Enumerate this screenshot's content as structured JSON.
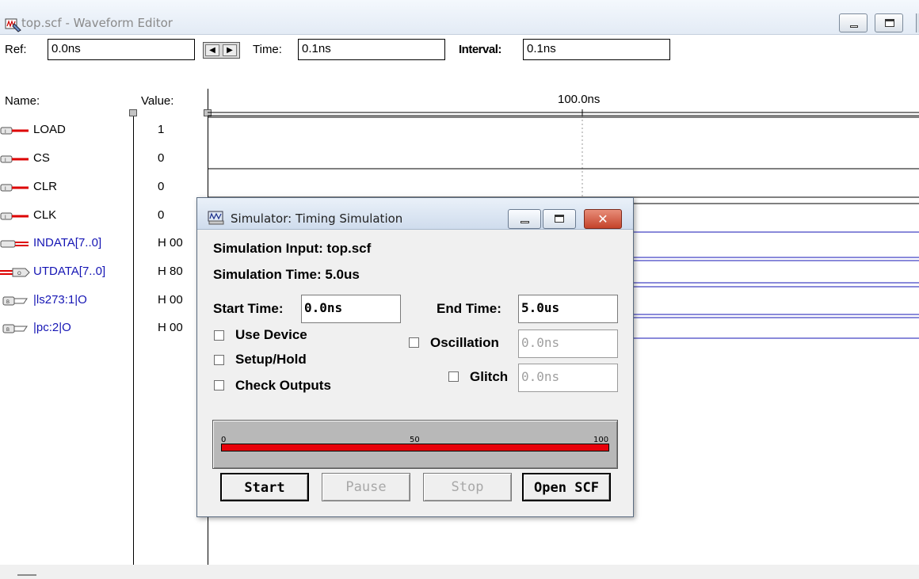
{
  "window": {
    "title": "top.scf - Waveform Editor"
  },
  "toolbar": {
    "ref_label": "Ref:",
    "ref_value": "0.0ns",
    "time_label": "Time:",
    "time_value": "0.1ns",
    "interval_label": "Interval:",
    "interval_value": "0.1ns"
  },
  "waveform": {
    "name_header": "Name:",
    "value_header": "Value:",
    "time_marker": "100.0ns",
    "signals": [
      {
        "name": "LOAD",
        "value": "1",
        "icon": "input-pin-icon",
        "color": "#000000"
      },
      {
        "name": "CS",
        "value": "0",
        "icon": "input-pin-icon",
        "color": "#000000"
      },
      {
        "name": "CLR",
        "value": "0",
        "icon": "input-pin-icon",
        "color": "#000000"
      },
      {
        "name": "CLK",
        "value": "0",
        "icon": "input-pin-icon",
        "color": "#000000"
      },
      {
        "name": "INDATA[7..0]",
        "value": "H 00",
        "icon": "input-bus-icon",
        "color": "#1515b4"
      },
      {
        "name": "UTDATA[7..0]",
        "value": "H 80",
        "icon": "output-bus-icon",
        "color": "#1515b4"
      },
      {
        "name": "|ls273:1|O",
        "value": "H 00",
        "icon": "buried-node-icon",
        "color": "#1515b4"
      },
      {
        "name": "|pc:2|O",
        "value": "H 00",
        "icon": "buried-node-icon",
        "color": "#1515b4"
      }
    ]
  },
  "dialog": {
    "title": "Simulator: Timing Simulation",
    "input_label": "Simulation Input: top.scf",
    "time_label": "Simulation Time: 5.0us",
    "start_time_label": "Start Time:",
    "start_time_value": "0.0ns",
    "end_time_label": "End Time:",
    "end_time_value": "5.0us",
    "use_device_label": "Use Device",
    "setup_hold_label": "Setup/Hold",
    "check_outputs_label": "Check Outputs",
    "oscillation_label": "Oscillation",
    "oscillation_value": "0.0ns",
    "glitch_label": "Glitch",
    "glitch_value": "0.0ns",
    "progress": {
      "min_label": "0",
      "mid_label": "50",
      "max_label": "100",
      "value": 100
    },
    "buttons": {
      "start": "Start",
      "pause": "Pause",
      "stop": "Stop",
      "open_scf": "Open SCF"
    }
  },
  "colors": {
    "progress_fill": "#e8000a",
    "bus_wave": "#1515b4",
    "close_button": "#c4432b"
  }
}
